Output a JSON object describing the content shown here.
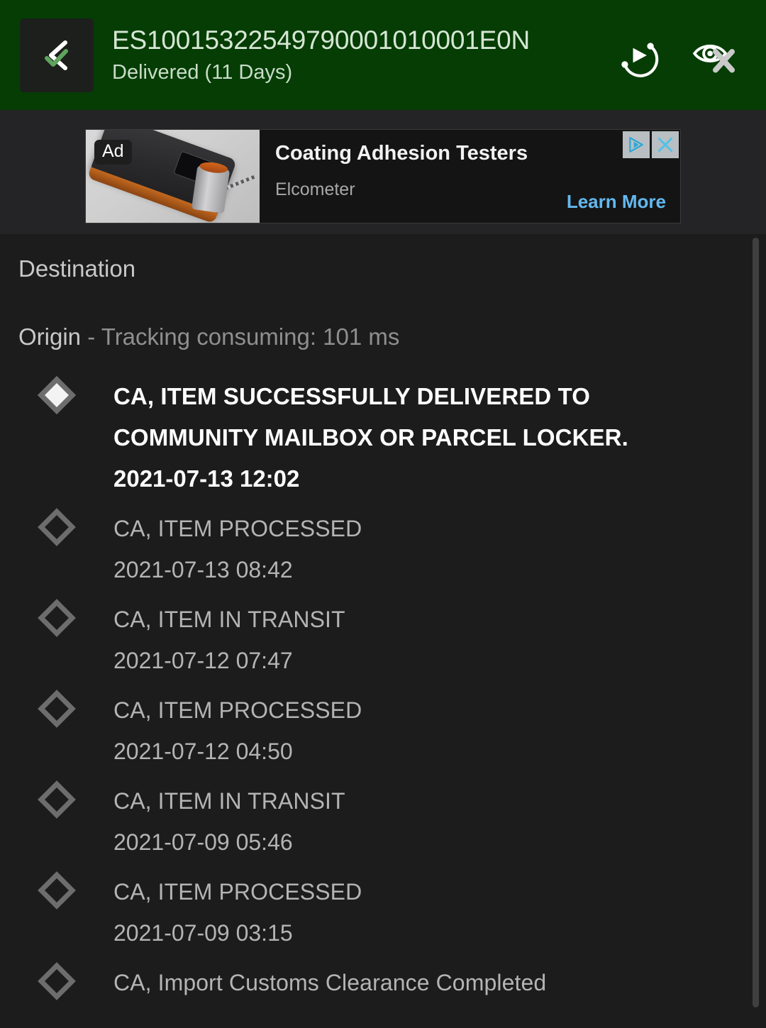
{
  "header": {
    "logo_icon": "chevron-check-logo-icon",
    "tracking_number": "ES10015322549790001010001E0N",
    "status": "Delivered (11 Days)",
    "actions": [
      {
        "icon": "auto-refresh-play-icon",
        "name": "auto-track-button"
      },
      {
        "icon": "eye-off-icon",
        "name": "hide-visibility-button"
      }
    ],
    "background_color": "#053d05",
    "title_color": "#d6e6d4"
  },
  "ad": {
    "badge": "Ad",
    "title": "Coating Adhesion Testers",
    "advertiser": "Elcometer",
    "cta": "Learn More",
    "cta_color": "#63b8ef",
    "adchoices_icon": "adchoices-triangle-icon",
    "close_icon": "close-x-icon",
    "image_alt": "coating-adhesion-tester-device"
  },
  "body": {
    "destination_label": "Destination",
    "origin_label": "Origin",
    "tracking_meta": "- Tracking consuming: 101 ms",
    "label_color": "#c8c8c8",
    "meta_color": "#8f8f8f"
  },
  "timeline": {
    "events": [
      {
        "event": "CA, ITEM SUCCESSFULLY DELIVERED TO COMMUNITY MAILBOX OR PARCEL LOCKER.",
        "time": "2021-07-13 12:02",
        "current": true
      },
      {
        "event": "CA, ITEM PROCESSED",
        "time": "2021-07-13 08:42",
        "current": false
      },
      {
        "event": "CA, ITEM IN TRANSIT",
        "time": "2021-07-12 07:47",
        "current": false
      },
      {
        "event": "CA, ITEM PROCESSED",
        "time": "2021-07-12 04:50",
        "current": false
      },
      {
        "event": "CA, ITEM IN TRANSIT",
        "time": "2021-07-09 05:46",
        "current": false
      },
      {
        "event": "CA, ITEM PROCESSED",
        "time": "2021-07-09 03:15",
        "current": false
      },
      {
        "event": "CA, Import Customs Clearance Completed",
        "time": "",
        "current": false
      }
    ]
  },
  "scrollbar": {
    "name": "vertical-scrollbar"
  }
}
